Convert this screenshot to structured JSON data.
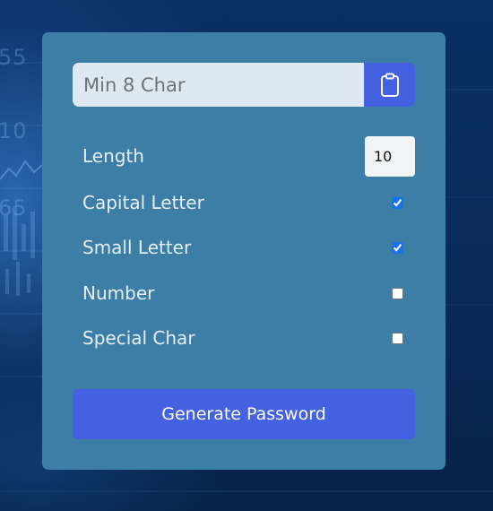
{
  "password": {
    "placeholder": "Min 8 Char",
    "value": ""
  },
  "copy_button": {
    "icon": "clipboard-icon"
  },
  "options": {
    "length": {
      "label": "Length",
      "value": "10"
    },
    "capital": {
      "label": "Capital Letter",
      "checked": true
    },
    "small": {
      "label": "Small Letter",
      "checked": true
    },
    "number": {
      "label": "Number",
      "checked": false
    },
    "special": {
      "label": "Special Char",
      "checked": false
    }
  },
  "generate_button": {
    "label": "Generate Password"
  },
  "colors": {
    "card": "#3d7ea6",
    "accent": "#4361e0",
    "input_bg": "#dde8f0"
  },
  "background_text": [
    "55",
    "10",
    "65"
  ]
}
